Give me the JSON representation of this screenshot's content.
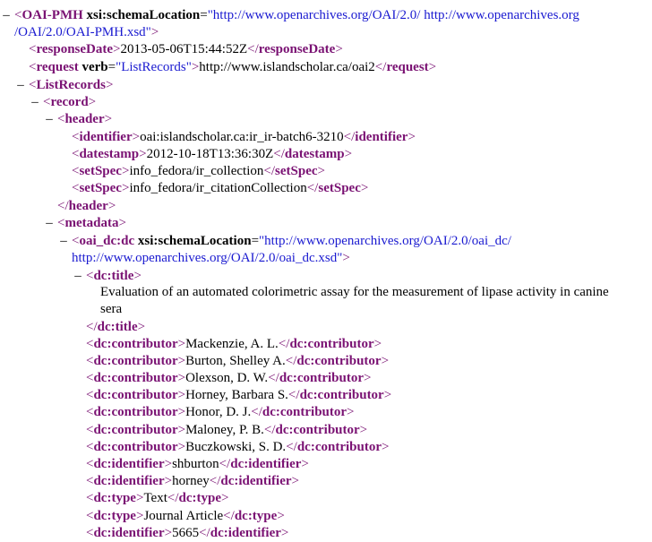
{
  "toggle_glyph": "–",
  "colors": {
    "tag": "#7a1273",
    "attribute_value": "#1a1ad0",
    "text": "#000000",
    "background": "#ffffff"
  },
  "lines": [
    {
      "toggle": true,
      "parts": [
        [
          "br",
          "<"
        ],
        [
          "tag",
          "OAI-PMH"
        ],
        [
          "attr",
          " xsi:schemaLocation"
        ],
        [
          "txt",
          "="
        ],
        [
          "val",
          "\"http://www.openarchives.org/OAI/2.0/ http://www.openarchives.org"
        ]
      ]
    },
    {
      "parts": [
        [
          "val",
          "/OAI/2.0/OAI-PMH.xsd\""
        ],
        [
          "br",
          ">"
        ]
      ]
    },
    {
      "parts": [
        [
          "br",
          "<"
        ],
        [
          "tag",
          "responseDate"
        ],
        [
          "br",
          ">"
        ],
        [
          "txt",
          "2013-05-06T15:44:52Z"
        ],
        [
          "br",
          "</"
        ],
        [
          "tag",
          "responseDate"
        ],
        [
          "br",
          ">"
        ]
      ]
    },
    {
      "parts": [
        [
          "br",
          "<"
        ],
        [
          "tag",
          "request"
        ],
        [
          "attr",
          " verb"
        ],
        [
          "txt",
          "="
        ],
        [
          "val",
          "\"ListRecords\""
        ],
        [
          "br",
          ">"
        ],
        [
          "txt",
          "http://www.islandscholar.ca/oai2"
        ],
        [
          "br",
          "</"
        ],
        [
          "tag",
          "request"
        ],
        [
          "br",
          ">"
        ]
      ]
    },
    {
      "toggle": true,
      "parts": [
        [
          "br",
          "<"
        ],
        [
          "tag",
          "ListRecords"
        ],
        [
          "br",
          ">"
        ]
      ]
    },
    {
      "toggle": true,
      "parts": [
        [
          "br",
          "<"
        ],
        [
          "tag",
          "record"
        ],
        [
          "br",
          ">"
        ]
      ]
    },
    {
      "toggle": true,
      "parts": [
        [
          "br",
          "<"
        ],
        [
          "tag",
          "header"
        ],
        [
          "br",
          ">"
        ]
      ]
    },
    {
      "parts": [
        [
          "br",
          "<"
        ],
        [
          "tag",
          "identifier"
        ],
        [
          "br",
          ">"
        ],
        [
          "txt",
          "oai:islandscholar.ca:ir_ir-batch6-3210"
        ],
        [
          "br",
          "</"
        ],
        [
          "tag",
          "identifier"
        ],
        [
          "br",
          ">"
        ]
      ]
    },
    {
      "parts": [
        [
          "br",
          "<"
        ],
        [
          "tag",
          "datestamp"
        ],
        [
          "br",
          ">"
        ],
        [
          "txt",
          "2012-10-18T13:36:30Z"
        ],
        [
          "br",
          "</"
        ],
        [
          "tag",
          "datestamp"
        ],
        [
          "br",
          ">"
        ]
      ]
    },
    {
      "parts": [
        [
          "br",
          "<"
        ],
        [
          "tag",
          "setSpec"
        ],
        [
          "br",
          ">"
        ],
        [
          "txt",
          "info_fedora/ir_collection"
        ],
        [
          "br",
          "</"
        ],
        [
          "tag",
          "setSpec"
        ],
        [
          "br",
          ">"
        ]
      ]
    },
    {
      "parts": [
        [
          "br",
          "<"
        ],
        [
          "tag",
          "setSpec"
        ],
        [
          "br",
          ">"
        ],
        [
          "txt",
          "info_fedora/ir_citationCollection"
        ],
        [
          "br",
          "</"
        ],
        [
          "tag",
          "setSpec"
        ],
        [
          "br",
          ">"
        ]
      ]
    },
    {
      "parts": [
        [
          "br",
          "</"
        ],
        [
          "tag",
          "header"
        ],
        [
          "br",
          ">"
        ]
      ]
    },
    {
      "toggle": true,
      "parts": [
        [
          "br",
          "<"
        ],
        [
          "tag",
          "metadata"
        ],
        [
          "br",
          ">"
        ]
      ]
    },
    {
      "toggle": true,
      "parts": [
        [
          "br",
          "<"
        ],
        [
          "tag",
          "oai_dc:dc"
        ],
        [
          "attr",
          " xsi:schemaLocation"
        ],
        [
          "txt",
          "="
        ],
        [
          "val",
          "\"http://www.openarchives.org/OAI/2.0/oai_dc/"
        ]
      ]
    },
    {
      "parts": [
        [
          "val",
          "http://www.openarchives.org/OAI/2.0/oai_dc.xsd\""
        ],
        [
          "br",
          ">"
        ]
      ]
    },
    {
      "toggle": true,
      "parts": [
        [
          "br",
          "<"
        ],
        [
          "tag",
          "dc:title"
        ],
        [
          "br",
          ">"
        ]
      ]
    },
    {
      "parts": [
        [
          "txt",
          "Evaluation of an automated colorimetric assay for the measurement of lipase activity in canine"
        ]
      ]
    },
    {
      "parts": [
        [
          "txt",
          "sera"
        ]
      ]
    },
    {
      "parts": [
        [
          "br",
          "</"
        ],
        [
          "tag",
          "dc:title"
        ],
        [
          "br",
          ">"
        ]
      ]
    },
    {
      "parts": [
        [
          "br",
          "<"
        ],
        [
          "tag",
          "dc:contributor"
        ],
        [
          "br",
          ">"
        ],
        [
          "txt",
          "Mackenzie, A. L."
        ],
        [
          "br",
          "</"
        ],
        [
          "tag",
          "dc:contributor"
        ],
        [
          "br",
          ">"
        ]
      ]
    },
    {
      "parts": [
        [
          "br",
          "<"
        ],
        [
          "tag",
          "dc:contributor"
        ],
        [
          "br",
          ">"
        ],
        [
          "txt",
          "Burton, Shelley A."
        ],
        [
          "br",
          "</"
        ],
        [
          "tag",
          "dc:contributor"
        ],
        [
          "br",
          ">"
        ]
      ]
    },
    {
      "parts": [
        [
          "br",
          "<"
        ],
        [
          "tag",
          "dc:contributor"
        ],
        [
          "br",
          ">"
        ],
        [
          "txt",
          "Olexson, D. W."
        ],
        [
          "br",
          "</"
        ],
        [
          "tag",
          "dc:contributor"
        ],
        [
          "br",
          ">"
        ]
      ]
    },
    {
      "parts": [
        [
          "br",
          "<"
        ],
        [
          "tag",
          "dc:contributor"
        ],
        [
          "br",
          ">"
        ],
        [
          "txt",
          "Horney, Barbara S."
        ],
        [
          "br",
          "</"
        ],
        [
          "tag",
          "dc:contributor"
        ],
        [
          "br",
          ">"
        ]
      ]
    },
    {
      "parts": [
        [
          "br",
          "<"
        ],
        [
          "tag",
          "dc:contributor"
        ],
        [
          "br",
          ">"
        ],
        [
          "txt",
          "Honor, D. J."
        ],
        [
          "br",
          "</"
        ],
        [
          "tag",
          "dc:contributor"
        ],
        [
          "br",
          ">"
        ]
      ]
    },
    {
      "parts": [
        [
          "br",
          "<"
        ],
        [
          "tag",
          "dc:contributor"
        ],
        [
          "br",
          ">"
        ],
        [
          "txt",
          "Maloney, P. B."
        ],
        [
          "br",
          "</"
        ],
        [
          "tag",
          "dc:contributor"
        ],
        [
          "br",
          ">"
        ]
      ]
    },
    {
      "parts": [
        [
          "br",
          "<"
        ],
        [
          "tag",
          "dc:contributor"
        ],
        [
          "br",
          ">"
        ],
        [
          "txt",
          "Buczkowski, S. D."
        ],
        [
          "br",
          "</"
        ],
        [
          "tag",
          "dc:contributor"
        ],
        [
          "br",
          ">"
        ]
      ]
    },
    {
      "parts": [
        [
          "br",
          "<"
        ],
        [
          "tag",
          "dc:identifier"
        ],
        [
          "br",
          ">"
        ],
        [
          "txt",
          "shburton"
        ],
        [
          "br",
          "</"
        ],
        [
          "tag",
          "dc:identifier"
        ],
        [
          "br",
          ">"
        ]
      ]
    },
    {
      "parts": [
        [
          "br",
          "<"
        ],
        [
          "tag",
          "dc:identifier"
        ],
        [
          "br",
          ">"
        ],
        [
          "txt",
          "horney"
        ],
        [
          "br",
          "</"
        ],
        [
          "tag",
          "dc:identifier"
        ],
        [
          "br",
          ">"
        ]
      ]
    },
    {
      "parts": [
        [
          "br",
          "<"
        ],
        [
          "tag",
          "dc:type"
        ],
        [
          "br",
          ">"
        ],
        [
          "txt",
          "Text"
        ],
        [
          "br",
          "</"
        ],
        [
          "tag",
          "dc:type"
        ],
        [
          "br",
          ">"
        ]
      ]
    },
    {
      "parts": [
        [
          "br",
          "<"
        ],
        [
          "tag",
          "dc:type"
        ],
        [
          "br",
          ">"
        ],
        [
          "txt",
          "Journal Article"
        ],
        [
          "br",
          "</"
        ],
        [
          "tag",
          "dc:type"
        ],
        [
          "br",
          ">"
        ]
      ]
    },
    {
      "parts": [
        [
          "br",
          "<"
        ],
        [
          "tag",
          "dc:identifier"
        ],
        [
          "br",
          ">"
        ],
        [
          "txt",
          "5665"
        ],
        [
          "br",
          "</"
        ],
        [
          "tag",
          "dc:identifier"
        ],
        [
          "br",
          ">"
        ]
      ]
    }
  ]
}
